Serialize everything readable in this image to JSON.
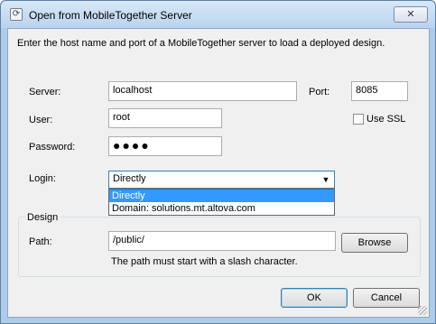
{
  "window": {
    "title": "Open from MobileTogether Server",
    "close_label": "✕"
  },
  "intro_text": "Enter the host name and port of a MobileTogether server to load a deployed design.",
  "server": {
    "label": "Server:",
    "value": "localhost"
  },
  "port": {
    "label": "Port:",
    "value": "8085"
  },
  "user": {
    "label": "User:",
    "value": "root"
  },
  "use_ssl": {
    "label": "Use SSL",
    "checked": false
  },
  "password": {
    "label": "Password:",
    "value": "●●●●"
  },
  "login": {
    "label": "Login:",
    "selected": "Directly",
    "options": [
      "Directly",
      "Domain: solutions.mt.altova.com"
    ]
  },
  "design": {
    "caption": "Design",
    "path_label": "Path:",
    "path_value": "/public/",
    "browse_label": "Browse",
    "hint": "The path must start with a slash character."
  },
  "buttons": {
    "ok": "OK",
    "cancel": "Cancel"
  }
}
